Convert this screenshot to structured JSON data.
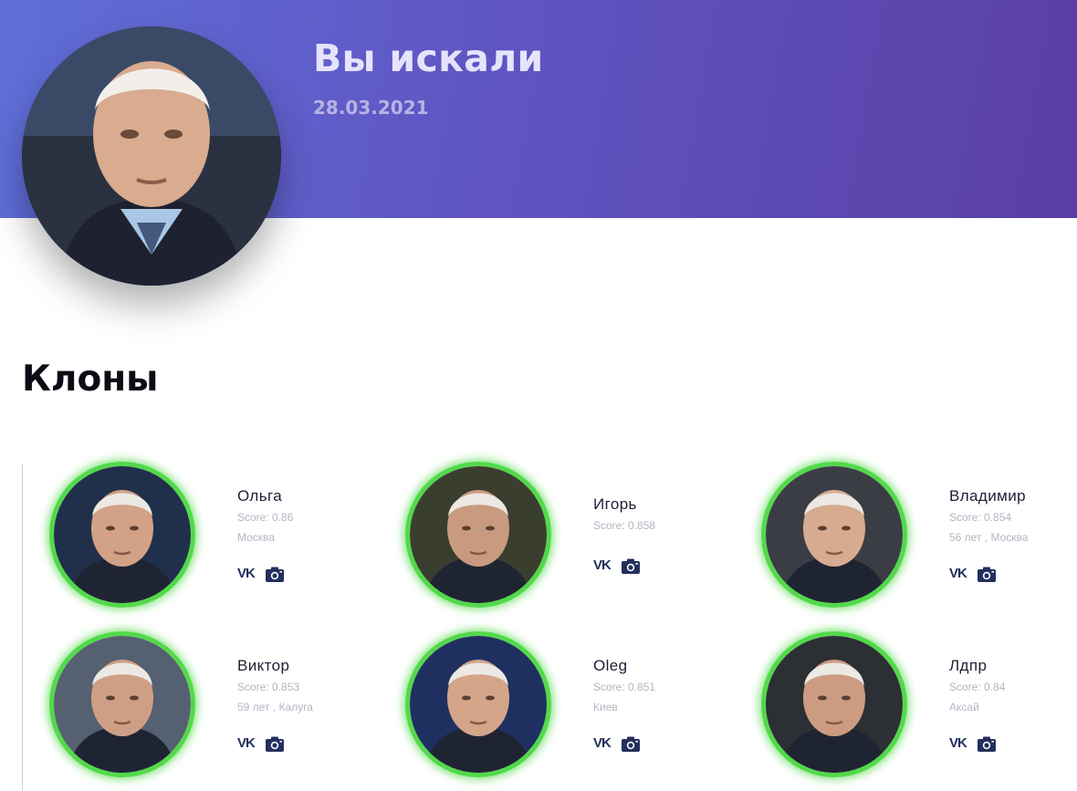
{
  "header": {
    "title": "Вы искали",
    "date": "28.03.2021",
    "colors": {
      "gradient_start": "#5f6fd9",
      "gradient_end": "#5a3fa4"
    }
  },
  "section": {
    "title": "Клоны"
  },
  "accent_color": "#52d94a",
  "icons": {
    "vk": "vk-icon",
    "camera": "camera-icon"
  },
  "clones": [
    {
      "name": "Ольга",
      "score": "Score: 0.86",
      "meta": "Москва",
      "vk_label": "VK"
    },
    {
      "name": "Игорь",
      "score": "Score: 0.858",
      "meta": "",
      "vk_label": "VK"
    },
    {
      "name": "Владимир",
      "score": "Score: 0.854",
      "meta": "56 лет , Москва",
      "vk_label": "VK"
    },
    {
      "name": "Виктор",
      "score": "Score: 0.853",
      "meta": "59 лет , Калуга",
      "vk_label": "VK"
    },
    {
      "name": "Oleg",
      "score": "Score: 0.851",
      "meta": "Киев",
      "vk_label": "VK"
    },
    {
      "name": "Лдпр",
      "score": "Score: 0.84",
      "meta": "Аксай",
      "vk_label": "VK"
    }
  ]
}
